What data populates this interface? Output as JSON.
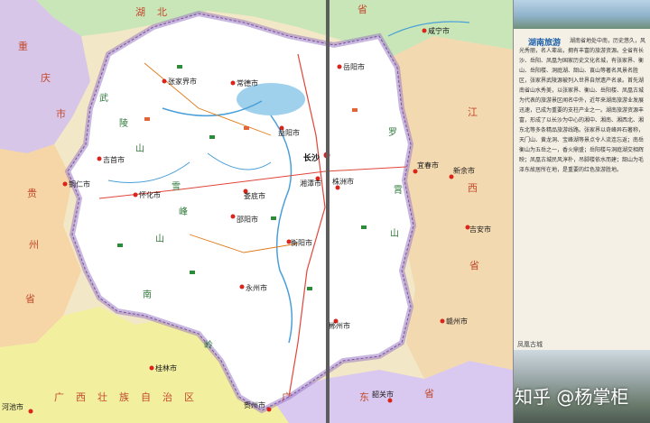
{
  "provinces": {
    "hubei": "湖　北",
    "sheng_top": "省",
    "chongqing_1": "重",
    "chongqing_2": "庆",
    "chongqing_3": "市",
    "guizhou_1": "贵",
    "guizhou_2": "州",
    "guizhou_3": "省",
    "jiangxi_1": "江",
    "jiangxi_2": "西",
    "jiangxi_3": "省",
    "guangxi": "广　西　壮　族　自　治　区",
    "guangdong_1": "广",
    "guangdong_2": "东",
    "guangdong_3": "省"
  },
  "features": {
    "wuling_1": "武",
    "wuling_2": "陵",
    "wuling_3": "山",
    "xuefeng_1": "雪",
    "xuefeng_2": "峰",
    "xuefeng_3": "山",
    "luoxiao_1": "罗",
    "luoxiao_2": "霄",
    "luoxiao_3": "山",
    "nanling_1": "南",
    "nanling_2": "岭"
  },
  "cities": {
    "changsha": "长沙",
    "zhuzhou": "株洲市",
    "xiangtan": "湘潭市",
    "yueyang": "岳阳市",
    "changde": "常德市",
    "yiyang": "益阳市",
    "zhangjiajie": "张家界市",
    "jishou": "吉首市",
    "huaihua": "怀化市",
    "loudi": "娄底市",
    "shaoyang": "邵阳市",
    "hengyang": "衡阳市",
    "yongzhou": "永州市",
    "chenzhou": "郴州市",
    "xianning": "咸宁市",
    "yichun": "宜春市",
    "xinyu": "新余市",
    "jian": "吉安市",
    "ganzhou": "赣州市",
    "tongren": "铜仁市",
    "guilin": "桂林市",
    "hezhou": "贺州市",
    "hechi": "河池市",
    "shaoguan": "韶关市"
  },
  "panel": {
    "title": "湖南旅游",
    "body": "湖南省地处中南，历史悠久，风光秀丽，名人辈出，拥有丰富的旅游资源。全省有长沙、岳阳、凤凰为国家历史文化名城，有张家界、衡山、岳阳楼、洞庭湖、韶山、崀山等著名风景名胜区，张家界武陵源被列入世界自然遗产名录。首先湖南省山水秀美，以张家界、衡山、岳阳楼、凤凰古城为代表的旅游景区闻名中外，近年来湖南旅游业发展迅速，已成为重要的支柱产业之一。湖南旅游资源丰富，形成了以长沙为中心的湘中、湘南、湘西北、湘东北等多条精品旅游线路。张家界以奇峰异石著称，天门山、黄龙洞、宝峰湖等景点令人流连忘返；南岳衡山为五岳之一，香火鼎盛；岳阳楼与洞庭湖交相辉映；凤凰古城民风淳朴，吊脚楼依水而建；韶山为毛泽东故居所在地，是重要的红色旅游胜地。",
    "caption": "凤凰古城"
  },
  "watermark": "知乎 @杨掌柜"
}
